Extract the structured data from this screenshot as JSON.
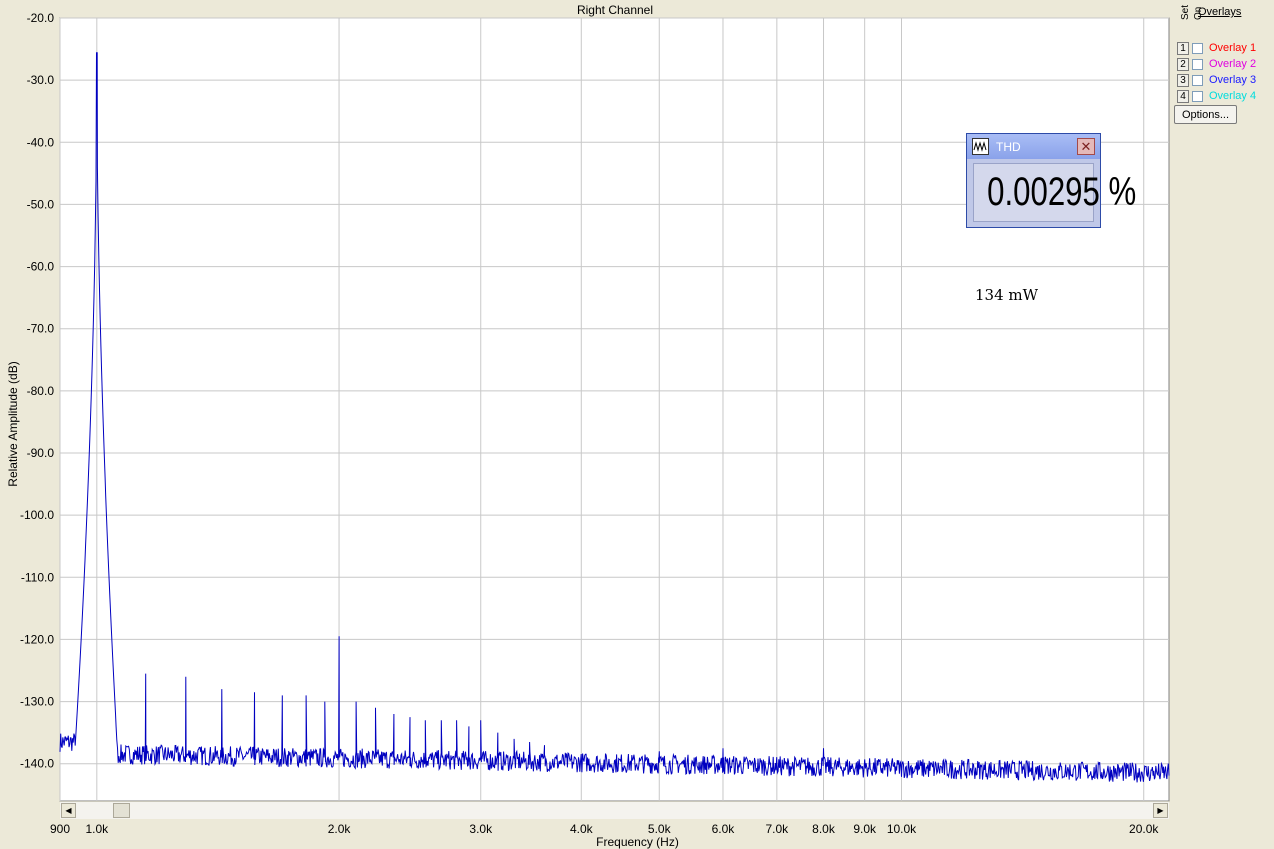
{
  "chart_data": {
    "type": "line",
    "title": "Right Channel",
    "xlabel": "Frequency (Hz)",
    "ylabel": "Relative Amplitude (dB)",
    "x_scale": "log",
    "xlim": [
      900,
      21500
    ],
    "ylim": [
      -146,
      -20
    ],
    "grid": true,
    "x_ticks": [
      900,
      1000,
      2000,
      3000,
      4000,
      5000,
      6000,
      7000,
      8000,
      9000,
      10000,
      20000
    ],
    "x_tick_labels": [
      "900",
      "1.0k",
      "2.0k",
      "3.0k",
      "4.0k",
      "5.0k",
      "6.0k",
      "7.0k",
      "8.0k",
      "9.0k",
      "10.0k",
      "20.0k"
    ],
    "y_ticks": [
      -20,
      -30,
      -40,
      -50,
      -60,
      -70,
      -80,
      -90,
      -100,
      -110,
      -120,
      -130,
      -140
    ],
    "y_tick_labels": [
      "-20.0",
      "-30.0",
      "-40.0",
      "-50.0",
      "-60.0",
      "-70.0",
      "-80.0",
      "-90.0",
      "-100.0",
      "-110.0",
      "-120.0",
      "-130.0",
      "-140.0"
    ],
    "series_color": "#0000c0",
    "fundamental": {
      "x": 1000,
      "y": -28.5
    },
    "noise_floor": {
      "low": -138.5,
      "high": -141.5
    },
    "spurs": [
      {
        "x": 1150,
        "y": -125.5
      },
      {
        "x": 1290,
        "y": -126.0
      },
      {
        "x": 1430,
        "y": -128.0
      },
      {
        "x": 1570,
        "y": -128.5
      },
      {
        "x": 1700,
        "y": -129.0
      },
      {
        "x": 1820,
        "y": -129.0
      },
      {
        "x": 1920,
        "y": -130.0
      },
      {
        "x": 2000,
        "y": -119.5
      },
      {
        "x": 2100,
        "y": -130.0
      },
      {
        "x": 2220,
        "y": -131.0
      },
      {
        "x": 2340,
        "y": -132.0
      },
      {
        "x": 2450,
        "y": -132.5
      },
      {
        "x": 2560,
        "y": -133.0
      },
      {
        "x": 2680,
        "y": -133.0
      },
      {
        "x": 2800,
        "y": -133.0
      },
      {
        "x": 2900,
        "y": -134.0
      },
      {
        "x": 3000,
        "y": -133.0
      },
      {
        "x": 3150,
        "y": -135.0
      },
      {
        "x": 3300,
        "y": -136.0
      },
      {
        "x": 3450,
        "y": -136.5
      },
      {
        "x": 3600,
        "y": -137.0
      },
      {
        "x": 5000,
        "y": -138.0
      },
      {
        "x": 6000,
        "y": -137.5
      },
      {
        "x": 8000,
        "y": -137.5
      }
    ]
  },
  "overlays": {
    "title": "Overlays",
    "set_label": "Set",
    "on_label": "On",
    "items": [
      {
        "num": "1",
        "label": "Overlay 1",
        "color": "#ff0000"
      },
      {
        "num": "2",
        "label": "Overlay 2",
        "color": "#e000e0"
      },
      {
        "num": "3",
        "label": "Overlay 3",
        "color": "#1a1aff"
      },
      {
        "num": "4",
        "label": "Overlay 4",
        "color": "#00dddd"
      }
    ],
    "options_label": "Options..."
  },
  "thd": {
    "title": "THD",
    "value": "0.00295 %"
  },
  "power_note": "134 mW"
}
